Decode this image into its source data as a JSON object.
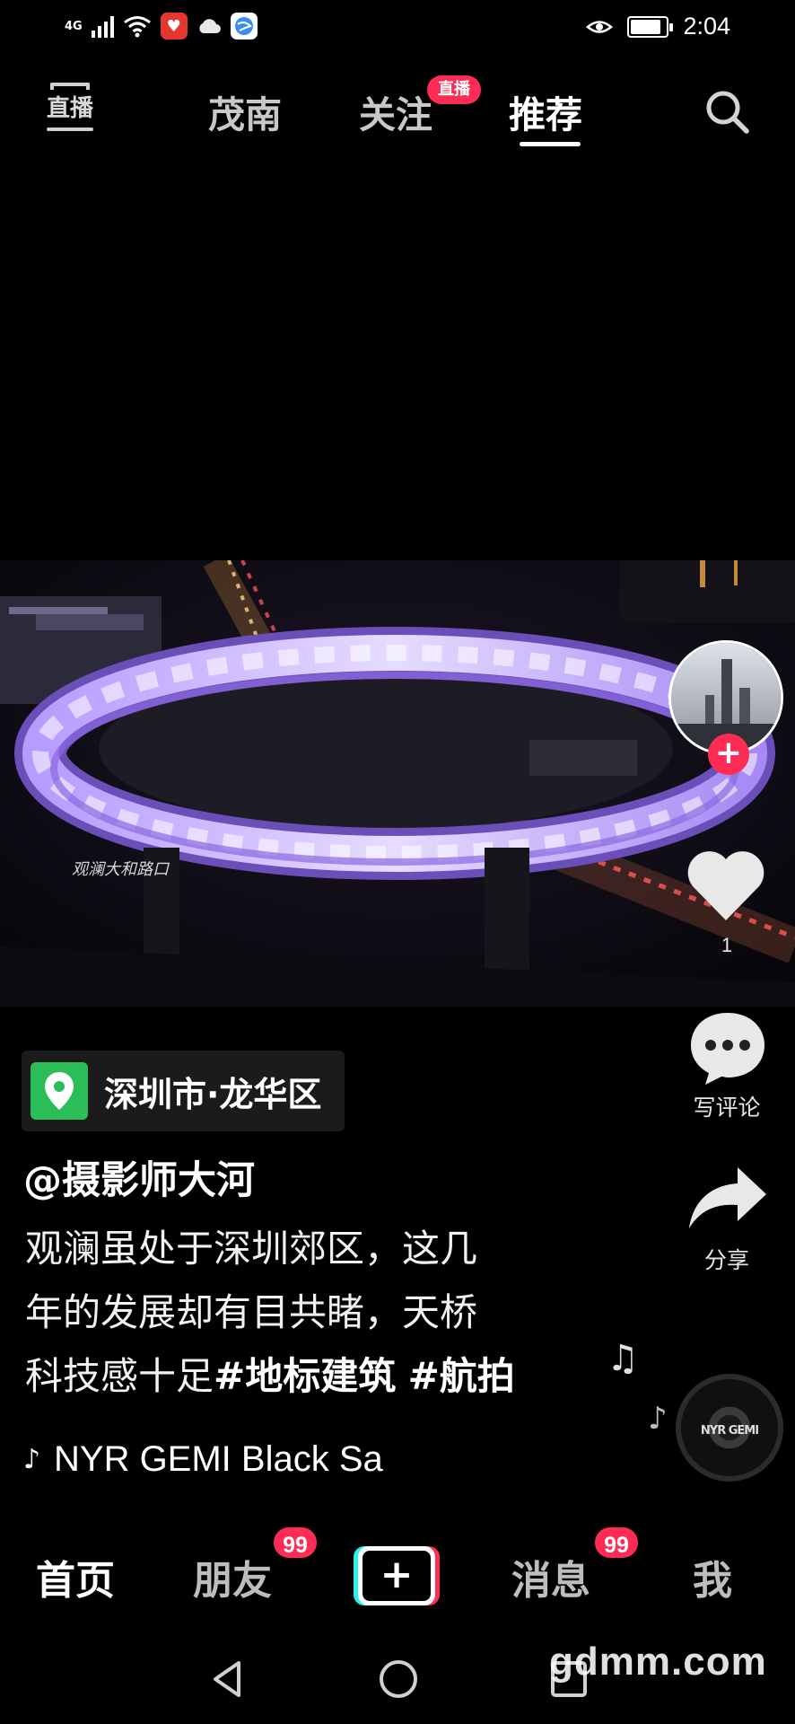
{
  "status_bar": {
    "network": "4G",
    "time": "2:04",
    "battery_level": 0.85,
    "icons": [
      "signal-icon",
      "wifi-icon",
      "app-notification-icon",
      "cloud-icon",
      "browser-icon",
      "eye-care-icon",
      "battery-icon"
    ]
  },
  "top_nav": {
    "live_label": "直播",
    "tabs": [
      {
        "label": "茂南"
      },
      {
        "label": "关注"
      },
      {
        "label": "推荐"
      }
    ],
    "follow_badge": "直播",
    "active_tab": "推荐"
  },
  "video": {
    "overlay_text": "观澜大和路口"
  },
  "side_actions": {
    "likes": "1",
    "comment_label": "写评论",
    "share_label": "分享"
  },
  "post": {
    "location": "深圳市·龙华区",
    "author": "@摄影师大河",
    "caption_lines": [
      "观澜虽处于深圳郊区，这几",
      "年的发展却有目共睹，天桥"
    ],
    "caption_line3": "科技感十足",
    "hashtags": [
      "#地标建筑",
      "#航拍"
    ],
    "music": "NYR GEMI    Black Sa",
    "disc_label": "NYR GEMI"
  },
  "tab_bar": {
    "home": "首页",
    "friends": "朋友",
    "friends_badge": "99",
    "create": "+",
    "messages": "消息",
    "messages_badge": "99",
    "me": "我"
  },
  "watermark": "gdmm.com",
  "colors": {
    "accent": "#fe2c55",
    "location_green": "#2bbd57",
    "background": "#000000"
  }
}
